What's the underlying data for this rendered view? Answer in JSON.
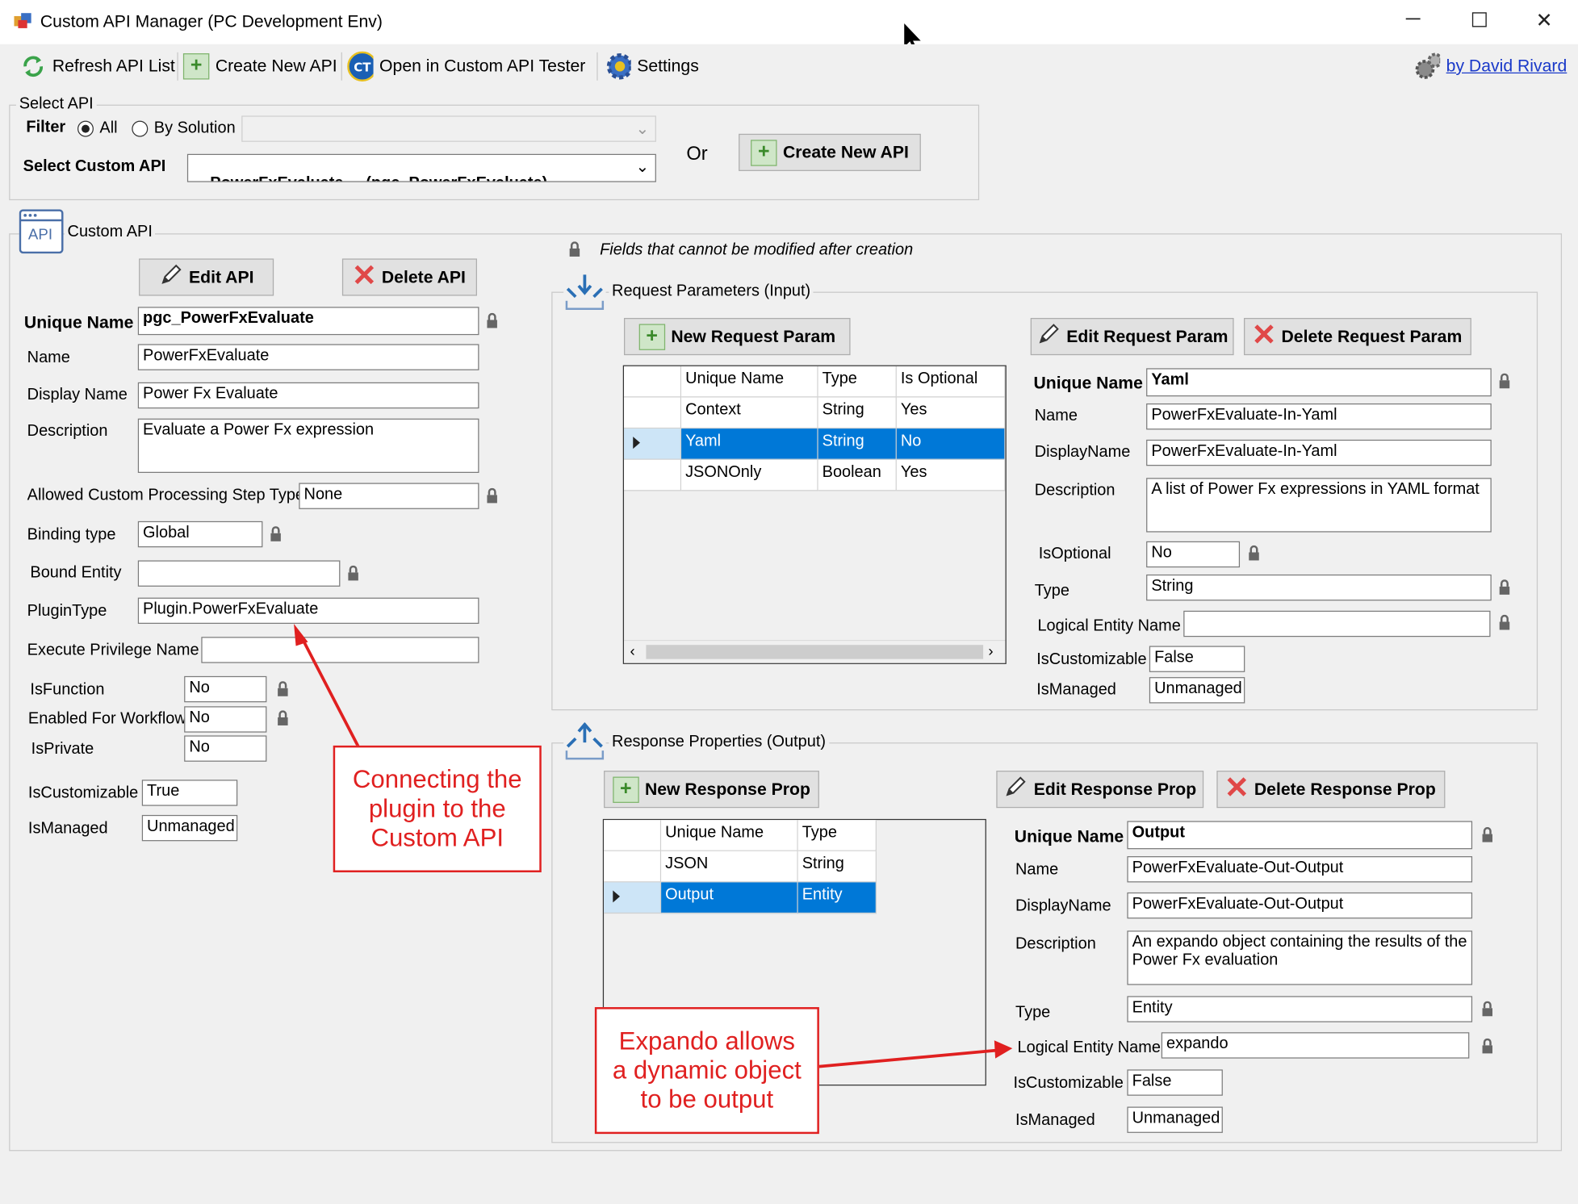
{
  "window": {
    "title": "Custom API Manager (PC Development Env)",
    "minimize": "─",
    "maximize": "☐",
    "close": "✕"
  },
  "toolbar": {
    "refresh": "Refresh API List",
    "create": "Create New API",
    "open_tester": "Open in Custom API Tester",
    "settings": "Settings",
    "author": "by David Rivard"
  },
  "select_api": {
    "legend": "Select API",
    "filter_label": "Filter",
    "radio_all": "All",
    "radio_by_solution": "By Solution",
    "solution_value": "",
    "select_label": "Select Custom API",
    "select_value": "PowerFxEvaluate     (pgc_PowerFxEvaluate)",
    "or_label": "Or",
    "create_button": "Create New API"
  },
  "custom_api": {
    "legend": "Custom API",
    "api_icon_text": "API",
    "edit_button": "Edit API",
    "delete_button": "Delete API",
    "lock_note": "Fields that cannot be modified after creation",
    "fields": {
      "unique_name_label": "Unique Name",
      "unique_name": "pgc_PowerFxEvaluate",
      "name_label": "Name",
      "name": "PowerFxEvaluate",
      "display_name_label": "Display Name",
      "display_name": "Power Fx Evaluate",
      "description_label": "Description",
      "description": "Evaluate a Power Fx expression",
      "step_type_label": "Allowed Custom Processing Step Type",
      "step_type": "None",
      "binding_type_label": "Binding type",
      "binding_type": "Global",
      "bound_entity_label": "Bound Entity",
      "bound_entity": "",
      "plugin_type_label": "PluginType",
      "plugin_type": "Plugin.PowerFxEvaluate",
      "exec_priv_label": "Execute Privilege Name",
      "exec_priv": "",
      "is_function_label": "IsFunction",
      "is_function": "No",
      "enabled_workflow_label": "Enabled For Workflow",
      "enabled_workflow": "No",
      "is_private_label": "IsPrivate",
      "is_private": "No",
      "is_customizable_label": "IsCustomizable",
      "is_customizable": "True",
      "is_managed_label": "IsManaged",
      "is_managed": "Unmanaged"
    }
  },
  "request": {
    "legend": "Request Parameters (Input)",
    "new_button": "New Request Param",
    "edit_button": "Edit Request Param",
    "delete_button": "Delete Request Param",
    "columns": [
      "Unique Name",
      "Type",
      "Is Optional"
    ],
    "rows": [
      [
        "Context",
        "String",
        "Yes"
      ],
      [
        "Yaml",
        "String",
        "No"
      ],
      [
        "JSONOnly",
        "Boolean",
        "Yes"
      ]
    ],
    "selected_row": 1,
    "detail": {
      "unique_name_label": "Unique Name",
      "unique_name": "Yaml",
      "name_label": "Name",
      "name": "PowerFxEvaluate-In-Yaml",
      "display_name_label": "DisplayName",
      "display_name": "PowerFxEvaluate-In-Yaml",
      "description_label": "Description",
      "description": "A list of Power Fx expressions in YAML format",
      "is_optional_label": "IsOptional",
      "is_optional": "No",
      "type_label": "Type",
      "type": "String",
      "logical_entity_label": "Logical Entity Name",
      "logical_entity": "",
      "is_customizable_label": "IsCustomizable",
      "is_customizable": "False",
      "is_managed_label": "IsManaged",
      "is_managed": "Unmanaged"
    }
  },
  "response": {
    "legend": "Response Properties (Output)",
    "new_button": "New Response Prop",
    "edit_button": "Edit Response Prop",
    "delete_button": "Delete Response Prop",
    "columns": [
      "Unique Name",
      "Type"
    ],
    "rows": [
      [
        "JSON",
        "String"
      ],
      [
        "Output",
        "Entity"
      ]
    ],
    "selected_row": 1,
    "detail": {
      "unique_name_label": "Unique Name",
      "unique_name": "Output",
      "name_label": "Name",
      "name": "PowerFxEvaluate-Out-Output",
      "display_name_label": "DisplayName",
      "display_name": "PowerFxEvaluate-Out-Output",
      "description_label": "Description",
      "description": "An expando object containing the results of the Power Fx evaluation",
      "type_label": "Type",
      "type": "Entity",
      "logical_entity_label": "Logical Entity Name",
      "logical_entity": "expando",
      "is_customizable_label": "IsCustomizable",
      "is_customizable": "False",
      "is_managed_label": "IsManaged",
      "is_managed": "Unmanaged"
    }
  },
  "annotations": {
    "plugin_callout": "Connecting the\nplugin to the\nCustom API",
    "expando_callout": "Expando allows\na dynamic object\nto be output"
  },
  "colors": {
    "selection": "#0078d7",
    "callout": "#e02020",
    "link": "#1a39c9"
  }
}
